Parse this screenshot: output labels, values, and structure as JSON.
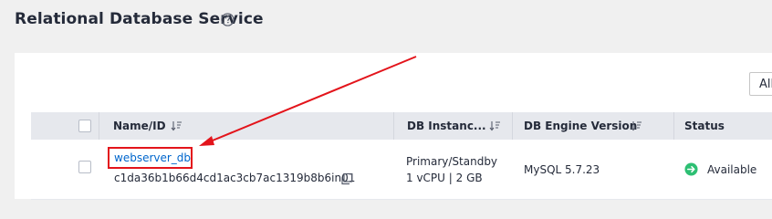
{
  "page": {
    "title": "Relational Database Service",
    "help_icon": "question-circle-icon"
  },
  "filter": {
    "visible_text": "All"
  },
  "table": {
    "headers": {
      "name_id": "Name/ID",
      "db_instance": "DB Instanc...",
      "db_engine_version": "DB Engine Version",
      "status": "Status"
    },
    "rows": [
      {
        "name": "webserver_db",
        "id": "c1da36b1b66d4cd1ac3cb7ac1319b8b6in01",
        "instance_type": "Primary/Standby",
        "instance_spec": "1 vCPU | 2 GB",
        "engine_version": "MySQL 5.7.23",
        "status": "Available",
        "status_color": "#2dbf73"
      }
    ]
  },
  "annotation": {
    "color": "#e3141b"
  }
}
